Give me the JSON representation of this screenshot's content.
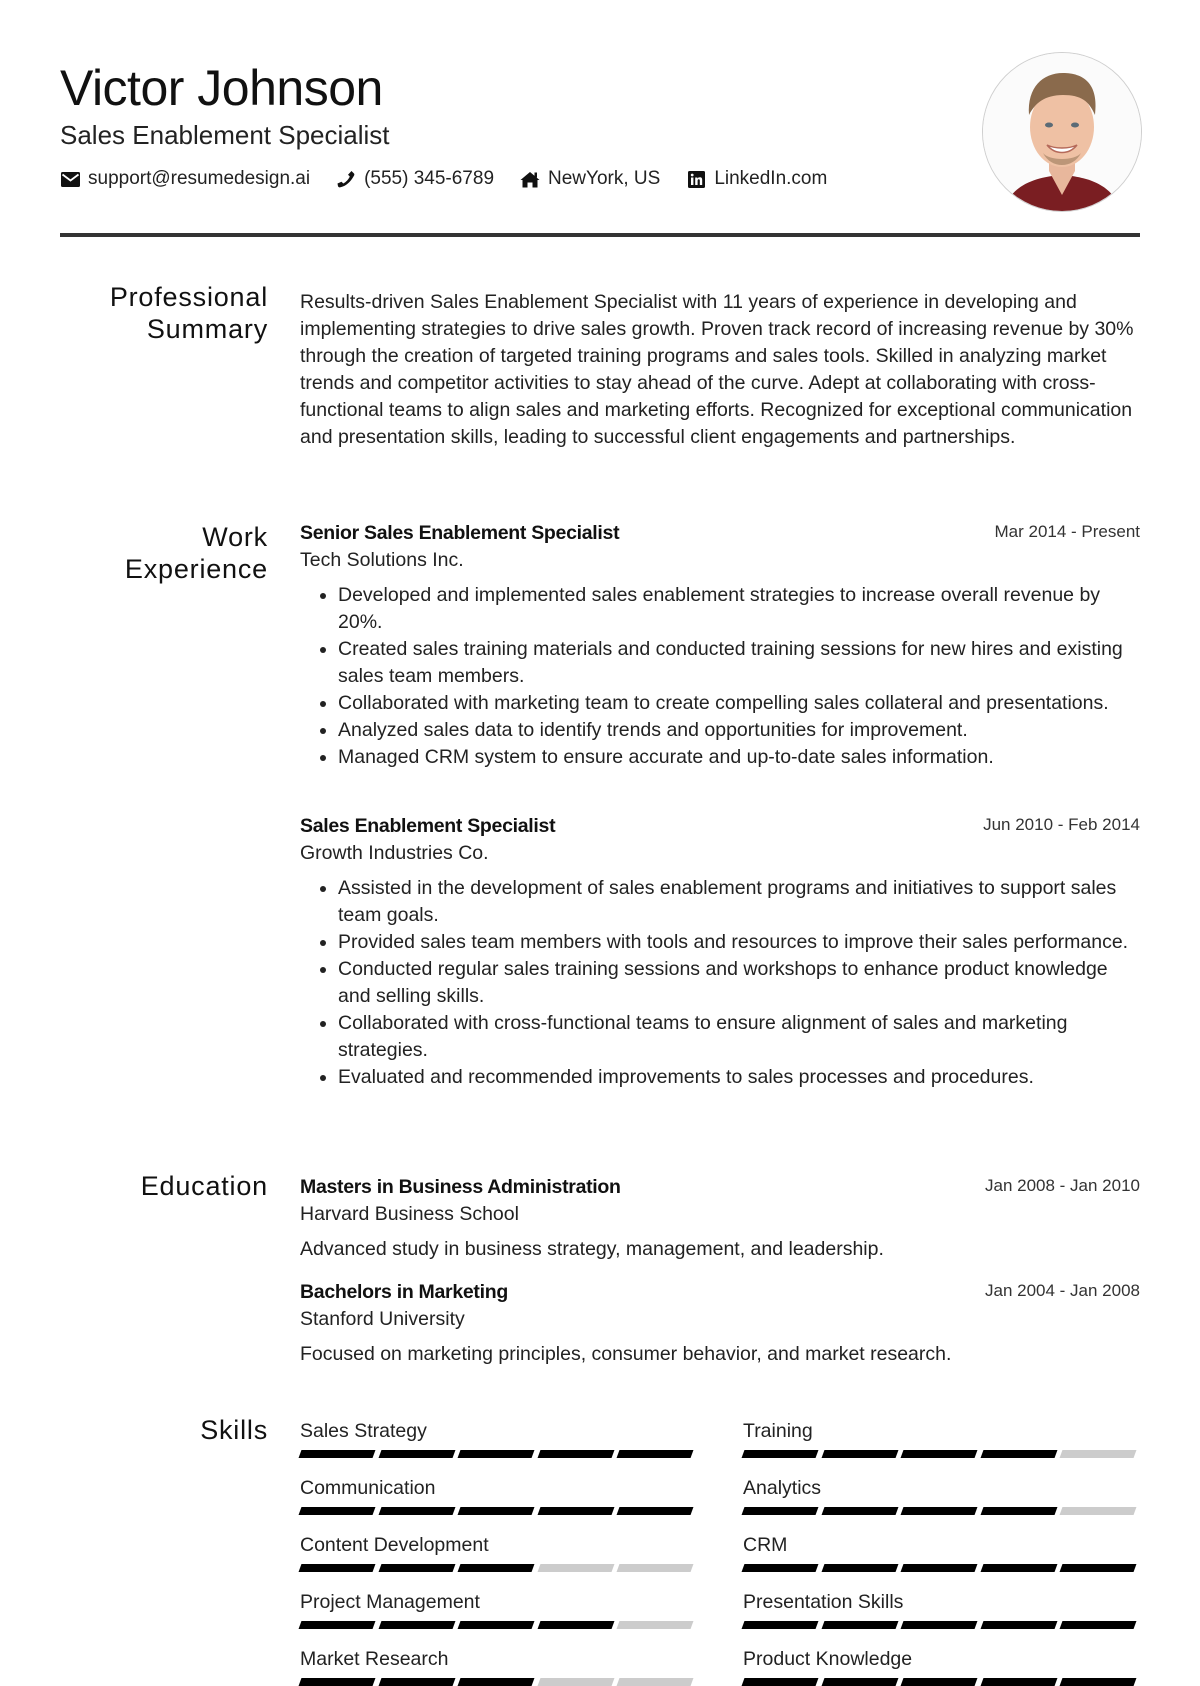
{
  "header": {
    "name": "Victor Johnson",
    "title": "Sales Enablement Specialist",
    "contacts": [
      {
        "icon": "envelope-icon",
        "text": "support@resumedesign.ai"
      },
      {
        "icon": "phone-icon",
        "text": "(555) 345-6789"
      },
      {
        "icon": "home-icon",
        "text": "NewYork, US"
      },
      {
        "icon": "linkedin-icon",
        "text": "LinkedIn.com"
      }
    ]
  },
  "sections": {
    "summary": {
      "title_line1": "Professional",
      "title_line2": "Summary",
      "text": "Results-driven Sales Enablement Specialist with 11 years of experience in developing and implementing strategies to drive sales growth. Proven track record of increasing revenue by 30% through the creation of targeted training programs and sales tools. Skilled in analyzing market trends and competitor activities to stay ahead of the curve. Adept at collaborating with cross-functional teams to align sales and marketing efforts. Recognized for exceptional communication and presentation skills, leading to successful client engagements and partnerships."
    },
    "experience": {
      "title_line1": "Work",
      "title_line2": "Experience",
      "jobs": [
        {
          "title": "Senior Sales Enablement Specialist",
          "company": "Tech Solutions Inc.",
          "dates": "Mar 2014 - Present",
          "bullets": [
            "Developed and implemented sales enablement strategies to increase overall revenue by 20%.",
            "Created sales training materials and conducted training sessions for new hires and existing sales team members.",
            "Collaborated with marketing team to create compelling sales collateral and presentations.",
            "Analyzed sales data to identify trends and opportunities for improvement.",
            "Managed CRM system to ensure accurate and up-to-date sales information."
          ]
        },
        {
          "title": "Sales Enablement Specialist",
          "company": "Growth Industries Co.",
          "dates": "Jun 2010 - Feb 2014",
          "bullets": [
            "Assisted in the development of sales enablement programs and initiatives to support sales team goals.",
            "Provided sales team members with tools and resources to improve their sales performance.",
            "Conducted regular sales training sessions and workshops to enhance product knowledge and selling skills.",
            "Collaborated with cross-functional teams to ensure alignment of sales and marketing strategies.",
            "Evaluated and recommended improvements to sales processes and procedures."
          ]
        }
      ]
    },
    "education": {
      "title": "Education",
      "items": [
        {
          "degree": "Masters in Business Administration",
          "school": "Harvard Business School",
          "dates": "Jan 2008 - Jan 2010",
          "description": "Advanced study in business strategy, management, and leadership."
        },
        {
          "degree": "Bachelors in Marketing",
          "school": "Stanford University",
          "dates": "Jan 2004 - Jan 2008",
          "description": "Focused on marketing principles, consumer behavior, and market research."
        }
      ]
    },
    "skills": {
      "title": "Skills",
      "max_level": 5,
      "items": [
        {
          "name": "Sales Strategy",
          "level": 5
        },
        {
          "name": "Training",
          "level": 4
        },
        {
          "name": "Communication",
          "level": 5
        },
        {
          "name": "Analytics",
          "level": 4
        },
        {
          "name": "Content Development",
          "level": 3
        },
        {
          "name": "CRM",
          "level": 5
        },
        {
          "name": "Project Management",
          "level": 4
        },
        {
          "name": "Presentation Skills",
          "level": 5
        },
        {
          "name": "Market Research",
          "level": 3
        },
        {
          "name": "Product Knowledge",
          "level": 5
        }
      ]
    }
  }
}
